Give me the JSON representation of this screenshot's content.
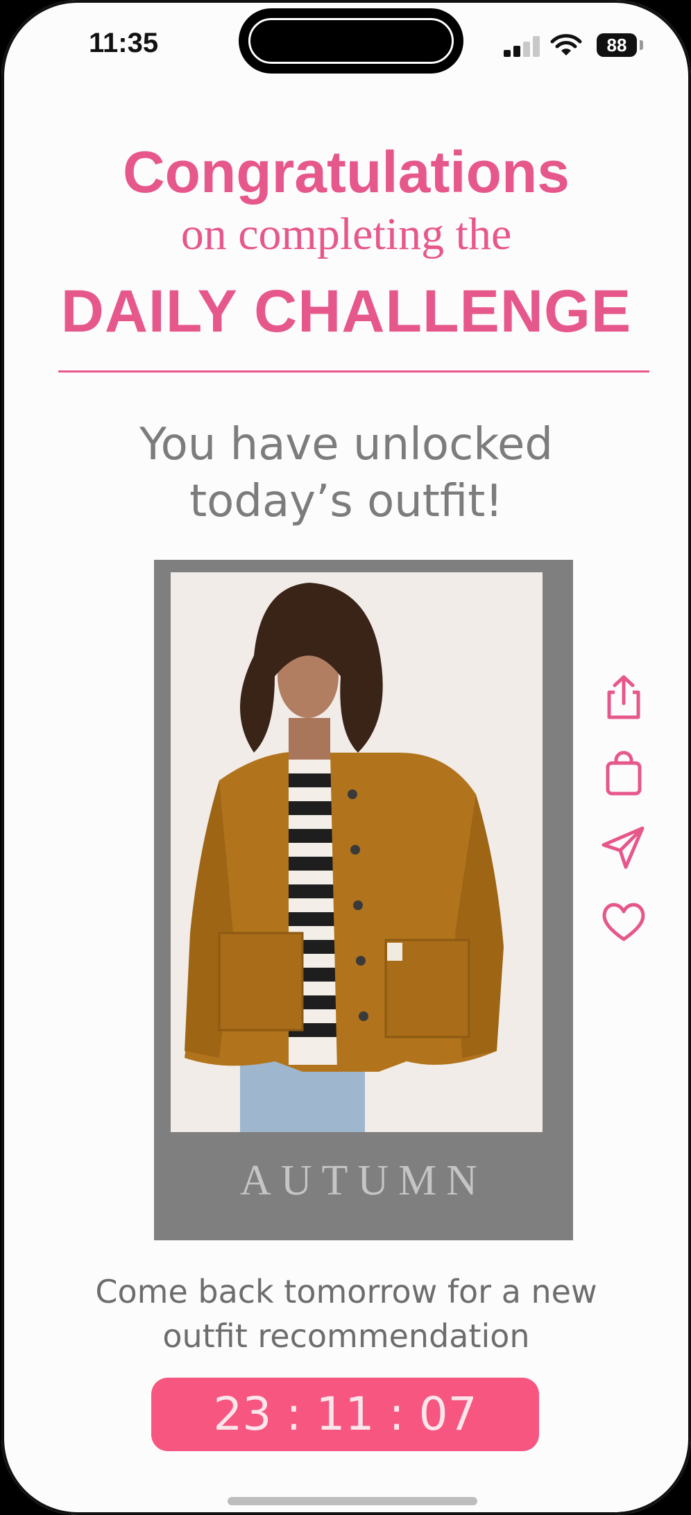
{
  "status_bar": {
    "time": "11:35",
    "battery": "88",
    "icons": [
      "signal-icon",
      "wifi-icon",
      "battery-icon"
    ]
  },
  "header": {
    "line1": "Congratulations",
    "line2": "on completing the",
    "line3": "DAILY CHALLENGE"
  },
  "message": {
    "line1": "You have unlocked",
    "line2": "today’s outfit!"
  },
  "outfit_card": {
    "season_label": "AUTUMN",
    "photo": "model-in-orange-corduroy-jacket"
  },
  "actions": [
    {
      "name": "share",
      "icon": "share-icon"
    },
    {
      "name": "shop",
      "icon": "shopping-bag-icon"
    },
    {
      "name": "send",
      "icon": "send-icon"
    },
    {
      "name": "like",
      "icon": "heart-icon"
    }
  ],
  "footer": {
    "line1": "Come back tomorrow for a new",
    "line2": "outfit recommendation",
    "countdown": "23 : 11 : 07"
  },
  "colors": {
    "accent": "#e6578b",
    "timer_bg": "#f6567f",
    "card_bg": "#7f7f7f",
    "text_gray": "#7c7c7c"
  }
}
